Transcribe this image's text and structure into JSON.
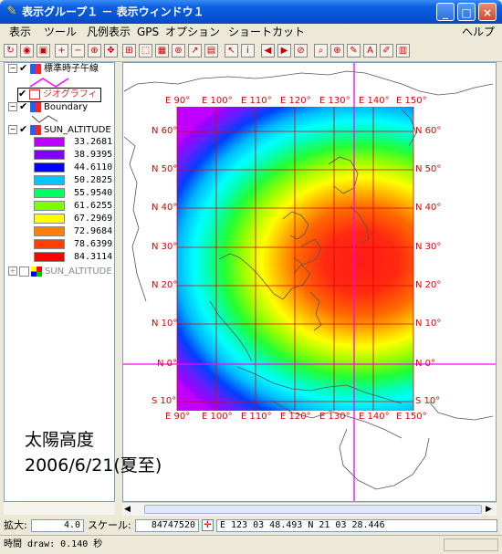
{
  "window": {
    "title": "表示グループ１ － 表示ウィンドウ１",
    "minimize": "_",
    "maximize": "□",
    "close": "×"
  },
  "menu": {
    "items": [
      "表示",
      "ツール",
      "凡例表示",
      "GPS",
      "オプション",
      "ショートカット"
    ],
    "help": "ヘルプ"
  },
  "layers": [
    {
      "label": "標準時子午線"
    },
    {
      "label": "ジオグラフィ"
    },
    {
      "label": "Boundary"
    },
    {
      "label": "SUN_ALTITUDE"
    },
    {
      "label": "SUN_ALTITUDE"
    }
  ],
  "legend": [
    {
      "value": "33.2681",
      "color": "#c000ff"
    },
    {
      "value": "38.9395",
      "color": "#8000ff"
    },
    {
      "value": "44.6110",
      "color": "#0000ff"
    },
    {
      "value": "50.2825",
      "color": "#00c8ff"
    },
    {
      "value": "55.9540",
      "color": "#00ff64"
    },
    {
      "value": "61.6255",
      "color": "#80ff00"
    },
    {
      "value": "67.2969",
      "color": "#ffff00"
    },
    {
      "value": "72.9684",
      "color": "#ff8000"
    },
    {
      "value": "78.6399",
      "color": "#ff4000"
    },
    {
      "value": "84.3114",
      "color": "#ff0000"
    }
  ],
  "map": {
    "lon_labels": [
      "E 90°",
      "E 100°",
      "E 110°",
      "E 120°",
      "E 130°",
      "E 140°",
      "E 150°"
    ],
    "lat_labels": [
      "N 60°",
      "N 50°",
      "N 40°",
      "N 30°",
      "N 20°",
      "N 10°",
      "N 0°",
      "S 10°"
    ],
    "overlay_title": "太陽高度",
    "overlay_date": "2006/6/21(夏至)"
  },
  "status": {
    "zoom_label": "拡大:",
    "zoom_value": "4.0",
    "scale_label": "スケール:",
    "scale_value": "84747520",
    "coords": "E 123 03 48.493  N 21 03 28.446",
    "draw_time": "時間 draw: 0.140 秒"
  },
  "colors": {
    "grid": "#e00000",
    "meridian": "#ff00ff",
    "titlebar": "#0a5fe0"
  }
}
